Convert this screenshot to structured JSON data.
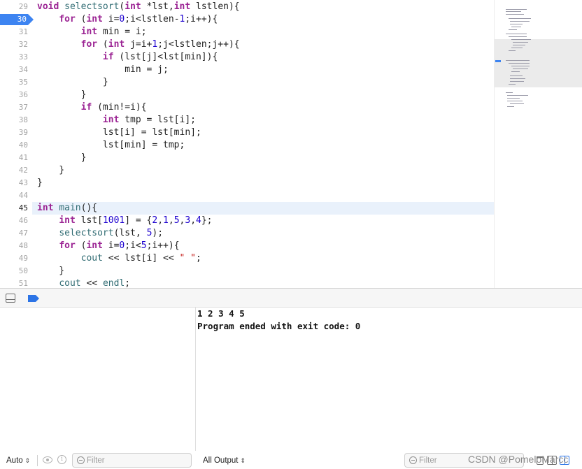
{
  "editor": {
    "current_line": "30",
    "line_numbers": [
      "29",
      "30",
      "31",
      "32",
      "33",
      "34",
      "35",
      "36",
      "37",
      "38",
      "39",
      "40",
      "41",
      "42",
      "43",
      "44",
      "45",
      "46",
      "47",
      "48",
      "49",
      "50",
      "51"
    ],
    "lines": [
      [
        {
          "t": "void",
          "c": "kw"
        },
        {
          "t": " "
        },
        {
          "t": "selectsort",
          "c": "fn"
        },
        {
          "t": "("
        },
        {
          "t": "int",
          "c": "kw"
        },
        {
          "t": " *lst,"
        },
        {
          "t": "int",
          "c": "kw"
        },
        {
          "t": " lstlen){"
        }
      ],
      [
        {
          "t": "    "
        },
        {
          "t": "for",
          "c": "kw"
        },
        {
          "t": " ("
        },
        {
          "t": "int",
          "c": "kw"
        },
        {
          "t": " i="
        },
        {
          "t": "0",
          "c": "num"
        },
        {
          "t": ";i<lstlen-"
        },
        {
          "t": "1",
          "c": "num"
        },
        {
          "t": ";i++){"
        }
      ],
      [
        {
          "t": "        "
        },
        {
          "t": "int",
          "c": "kw"
        },
        {
          "t": " min = i;"
        }
      ],
      [
        {
          "t": "        "
        },
        {
          "t": "for",
          "c": "kw"
        },
        {
          "t": " ("
        },
        {
          "t": "int",
          "c": "kw"
        },
        {
          "t": " j=i+"
        },
        {
          "t": "1",
          "c": "num"
        },
        {
          "t": ";j<lstlen;j++){"
        }
      ],
      [
        {
          "t": "            "
        },
        {
          "t": "if",
          "c": "kw"
        },
        {
          "t": " (lst[j]<lst[min]){"
        }
      ],
      [
        {
          "t": "                min = j;"
        }
      ],
      [
        {
          "t": "            }"
        }
      ],
      [
        {
          "t": "        }"
        }
      ],
      [
        {
          "t": "        "
        },
        {
          "t": "if",
          "c": "kw"
        },
        {
          "t": " (min!=i){"
        }
      ],
      [
        {
          "t": "            "
        },
        {
          "t": "int",
          "c": "kw"
        },
        {
          "t": " tmp = lst[i];"
        }
      ],
      [
        {
          "t": "            lst[i] = lst[min];"
        }
      ],
      [
        {
          "t": "            lst[min] = tmp;"
        }
      ],
      [
        {
          "t": "        }"
        }
      ],
      [
        {
          "t": "    }"
        }
      ],
      [
        {
          "t": "}"
        }
      ],
      [
        {
          "t": ""
        }
      ],
      [
        {
          "t": "int",
          "c": "kw"
        },
        {
          "t": " "
        },
        {
          "t": "main",
          "c": "fn"
        },
        {
          "t": "(){"
        }
      ],
      [
        {
          "t": "    "
        },
        {
          "t": "int",
          "c": "kw"
        },
        {
          "t": " lst["
        },
        {
          "t": "1001",
          "c": "num"
        },
        {
          "t": "] = {"
        },
        {
          "t": "2",
          "c": "num"
        },
        {
          "t": ","
        },
        {
          "t": "1",
          "c": "num"
        },
        {
          "t": ","
        },
        {
          "t": "5",
          "c": "num"
        },
        {
          "t": ","
        },
        {
          "t": "3",
          "c": "num"
        },
        {
          "t": ","
        },
        {
          "t": "4",
          "c": "num"
        },
        {
          "t": "};"
        }
      ],
      [
        {
          "t": "    "
        },
        {
          "t": "selectsort",
          "c": "fn"
        },
        {
          "t": "(lst, "
        },
        {
          "t": "5",
          "c": "num"
        },
        {
          "t": ");"
        }
      ],
      [
        {
          "t": "    "
        },
        {
          "t": "for",
          "c": "kw"
        },
        {
          "t": " ("
        },
        {
          "t": "int",
          "c": "kw"
        },
        {
          "t": " i="
        },
        {
          "t": "0",
          "c": "num"
        },
        {
          "t": ";i<"
        },
        {
          "t": "5",
          "c": "num"
        },
        {
          "t": ";i++){"
        }
      ],
      [
        {
          "t": "        "
        },
        {
          "t": "cout",
          "c": "fn"
        },
        {
          "t": " << lst[i] << "
        },
        {
          "t": "\" \"",
          "c": "str"
        },
        {
          "t": ";"
        }
      ],
      [
        {
          "t": "    }"
        }
      ],
      [
        {
          "t": "    "
        },
        {
          "t": "cout",
          "c": "fn"
        },
        {
          "t": " << "
        },
        {
          "t": "endl",
          "c": "fn"
        },
        {
          "t": ";"
        }
      ]
    ],
    "colors": {
      "keyword": "#9b2393",
      "function": "#326d74",
      "number": "#1c00cf",
      "string": "#c41a16",
      "breakpoint": "#3d84f1",
      "current_line_bg": "#e9f1fb"
    }
  },
  "console": {
    "output": [
      "1 2 3 4 5",
      "Program ended with exit code: 0"
    ]
  },
  "footer": {
    "scope_select": "Auto",
    "filter_placeholder_left": "Filter",
    "output_select": "All Output",
    "filter_placeholder_right": "Filter",
    "watermark": "CSDN @PomeloMarcc"
  },
  "icons": [
    "breakpoint-marker-icon",
    "toggle-panel-icon",
    "breakpoint-toggle-icon",
    "eye-icon",
    "info-icon",
    "search-filter-icon",
    "trash-icon",
    "split-left-icon",
    "split-right-icon",
    "chevron-updown-icon"
  ]
}
